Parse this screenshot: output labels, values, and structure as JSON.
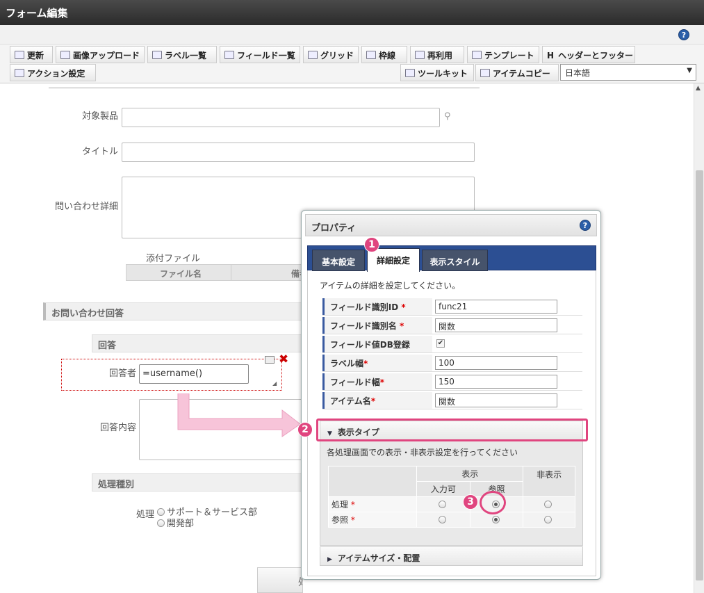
{
  "window": {
    "title": "フォーム編集"
  },
  "toolbar": {
    "row1": [
      {
        "name": "update-button",
        "icon": "update-icon",
        "label": "更新"
      },
      {
        "name": "image-upload-button",
        "icon": "image-upload-icon",
        "label": "画像アップロード"
      },
      {
        "name": "label-list-button",
        "icon": "list-icon",
        "label": "ラベル一覧"
      },
      {
        "name": "field-list-button",
        "icon": "list-icon",
        "label": "フィールド一覧"
      },
      {
        "name": "grid-button",
        "icon": "grid-icon",
        "label": "グリッド"
      },
      {
        "name": "border-button",
        "icon": "border-icon",
        "label": "枠線"
      },
      {
        "name": "reuse-button",
        "icon": "document-icon",
        "label": "再利用"
      },
      {
        "name": "template-button",
        "icon": "template-icon",
        "label": "テンプレート"
      },
      {
        "name": "header-footer-button",
        "icon": "header-icon",
        "label": "ヘッダーとフッター"
      }
    ],
    "row2_left": {
      "label": "アクション設定"
    },
    "toolkit": {
      "label": "ツールキット"
    },
    "item_copy": {
      "label": "アイテムコピー"
    },
    "language": {
      "value": "日本語"
    }
  },
  "form": {
    "product_label": "対象製品",
    "title_label": "タイトル",
    "inquiry_label": "問い合わせ詳細",
    "attachment_label": "添付ファイル",
    "attachment_cols": [
      "ファイル名",
      "備考"
    ],
    "answer_section": "お問い合わせ回答",
    "answer_sub": "回答",
    "responder_label": "回答者",
    "responder_value": "=username()",
    "answer_content_label": "回答内容",
    "process_section": "処理種別",
    "process_label": "処理",
    "process_options": [
      "サポート＆サービス部",
      "開発部"
    ],
    "bottom_button": "処"
  },
  "panel": {
    "title": "プロパティ",
    "tabs": [
      "基本設定",
      "詳細設定",
      "表示スタイル"
    ],
    "active_tab": 1,
    "description": "アイテムの詳細を設定してください。",
    "rows": [
      {
        "label": "フィールド識別ID",
        "required": true,
        "value": "func21"
      },
      {
        "label": "フィールド識別名",
        "required": true,
        "value": "関数"
      },
      {
        "label": "フィールド値DB登録",
        "required": false,
        "checked": true
      },
      {
        "label": "ラベル幅",
        "required": true,
        "value": "100"
      },
      {
        "label": "フィールド幅",
        "required": true,
        "value": "150"
      },
      {
        "label": "アイテム名",
        "required": true,
        "value": "関数"
      }
    ],
    "display_type": {
      "title": "表示タイプ",
      "description": "各処理画面での表示・非表示設定を行ってください",
      "header_display": "表示",
      "header_input": "入力可",
      "header_ref": "参照",
      "header_hidden": "非表示",
      "rows": [
        {
          "label": "処理",
          "selected": "ref"
        },
        {
          "label": "参照",
          "selected": "ref"
        }
      ]
    },
    "size_section": "アイテムサイズ・配置"
  },
  "badges": [
    "1",
    "2",
    "3"
  ],
  "colors": {
    "accent_pink": "#e0457f",
    "tab_bar": "#2c4f93",
    "required": "#dd0000"
  }
}
